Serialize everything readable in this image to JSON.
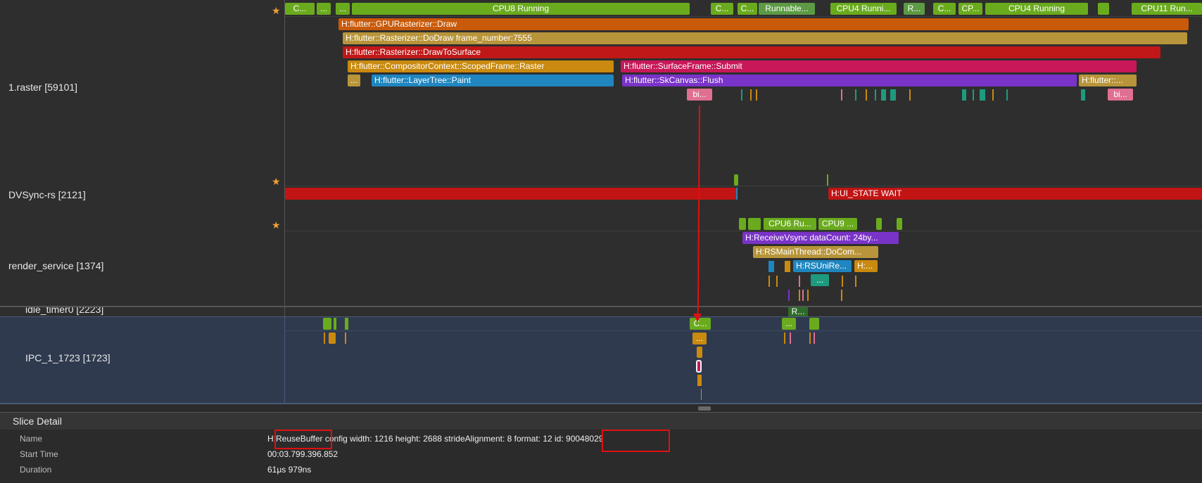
{
  "tracks": {
    "raster": {
      "name": "1.raster [59101]",
      "cpu": [
        "C...",
        "...",
        "...",
        "CPU8 Running",
        "C...",
        "C...",
        "Runnable...",
        "CPU4 Runni...",
        "R...",
        "C...",
        "CP...",
        "CPU4 Running",
        "CPU11 Run..."
      ],
      "slices": {
        "gpu_draw": "H:flutter::GPURasterizer::Draw",
        "do_draw": "H:flutter::Rasterizer::DoDraw frame_number:7555",
        "draw_to_surface": "H:flutter::Rasterizer::DrawToSurface",
        "scoped_frame": "H:flutter::CompositorContext::ScopedFrame::Raster",
        "surface_submit": "H:flutter::SurfaceFrame::Submit",
        "ellipsis_small": "...",
        "layer_tree_paint": "H:flutter::LayerTree::Paint",
        "skcanvas_flush": "H:flutter::SkCanvas::Flush",
        "flutter_short": "H:flutter::...",
        "bi_a": "bi...",
        "bi_b": "bi..."
      }
    },
    "dvsync": {
      "name": "DVSync-rs [2121]",
      "ui_state_wait": "H:UI_STATE WAIT"
    },
    "render_service": {
      "name": "render_service [1374]",
      "cpu6": "CPU6 Ru...",
      "cpu9": "CPU9 ...",
      "receive_vsync": "H:ReceiveVsync dataCount: 24by...",
      "rs_main_thread": "H:RSMainThread::DoCom...",
      "rs_uni": "H:RSUniRe...",
      "h_short": "H:...",
      "dots": "..."
    },
    "idle_timer": {
      "name": "idle_timer0 [2223]",
      "r_slice": "R..."
    },
    "ipc": {
      "name": "IPC_1_1723 [1723]",
      "c_slice": "C...",
      "dots_a": "...",
      "dots_b": "..."
    }
  },
  "slice_detail": {
    "title": "Slice Detail",
    "name_label": "Name",
    "name_value": "H:ReuseBuffer config width: 1216 height: 2688 strideAlignment: 8 format: 12 id: 90048029",
    "start_label": "Start Time",
    "start_value": "00:03.799.396.852",
    "duration_label": "Duration",
    "duration_value": "61μs 979ns"
  },
  "colors": {
    "annotation": "#e01010",
    "cpu_running": "#6aab1e",
    "star": "#f0a02c"
  }
}
